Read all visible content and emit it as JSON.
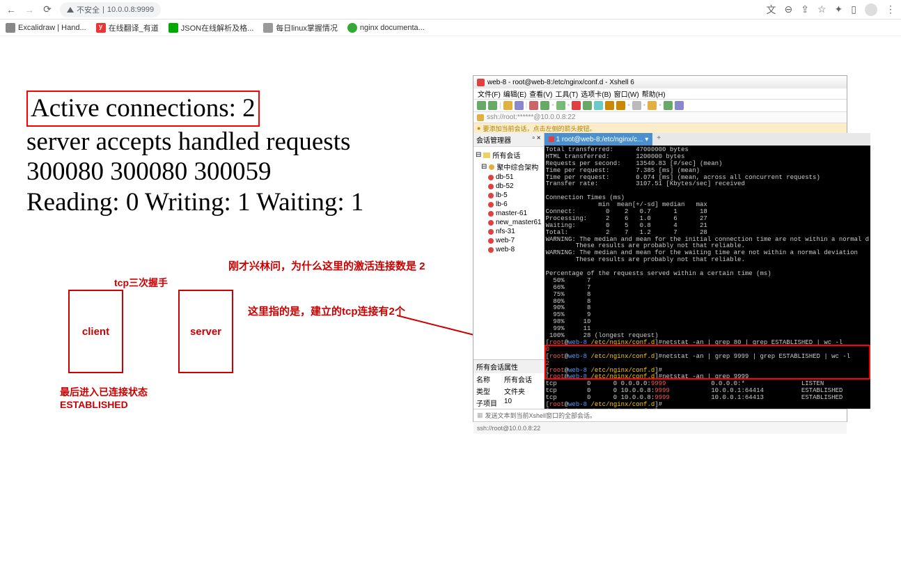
{
  "browser": {
    "not_secure": "不安全",
    "url": "10.0.0.8:9999",
    "bookmarks": [
      {
        "label": "Excalidraw | Hand...",
        "color": "#888"
      },
      {
        "label": "在线翻译_有道",
        "color": "#e33"
      },
      {
        "label": "JSON在线解析及格...",
        "color": "#3a3"
      },
      {
        "label": "每日linux掌握情况",
        "color": "#999"
      },
      {
        "label": "nginx documenta...",
        "color": "#3a3"
      }
    ]
  },
  "nginx": {
    "active_connections": "Active connections: 2 ",
    "line2": "server accepts handled requests",
    "line3": " 300080 300080 300059 ",
    "line4": "Reading: 0 Writing: 1 Waiting: 1"
  },
  "annot": {
    "q1": "刚才兴林问，为什么这里的激活连接数是 2",
    "q2": "这里指的是，建立的tcp连接有2个",
    "tcp_label": "tcp三次握手",
    "client_label": "client",
    "server_label": "server",
    "established": "最后进入已连接状态\nESTABLISHED"
  },
  "xshell": {
    "title": "web-8 - root@web-8:/etc/nginx/conf.d - Xshell 6",
    "menu": [
      "文件(F)",
      "编辑(E)",
      "查看(V)",
      "工具(T)",
      "选项卡(B)",
      "窗口(W)",
      "帮助(H)"
    ],
    "addr": "ssh://root:******@10.0.0.8:22",
    "hint": "要添加当前会话，点击左侧的箭头按钮。",
    "tree_title": "会话管理器",
    "tree_root": "所有会话",
    "tree": [
      {
        "label": "聚中综合架构",
        "color": "#e0b040"
      },
      {
        "label": "db-51",
        "color": "#e04040"
      },
      {
        "label": "db-52",
        "color": "#e04040"
      },
      {
        "label": "lb-5",
        "color": "#e04040"
      },
      {
        "label": "lb-6",
        "color": "#e04040"
      },
      {
        "label": "master-61",
        "color": "#e04040"
      },
      {
        "label": "new_master61",
        "color": "#e04040"
      },
      {
        "label": "nfs-31",
        "color": "#e04040"
      },
      {
        "label": "web-7",
        "color": "#e04040"
      },
      {
        "label": "web-8",
        "color": "#e04040"
      }
    ],
    "props_title": "所有会话属性",
    "props": [
      {
        "k": "名称",
        "v": "所有会话"
      },
      {
        "k": "类型",
        "v": "文件夹"
      },
      {
        "k": "子项目",
        "v": "10"
      }
    ],
    "tab": "1 root@web-8:/etc/nginx/c...",
    "term_pre": "Total transferred:      47000000 bytes\nHTML transferred:       1200000 bytes\nRequests per second:    13540.83 [#/sec] (mean)\nTime per request:       7.385 [ms] (mean)\nTime per request:       0.074 [ms] (mean, across all concurrent requests)\nTransfer rate:          3107.51 [Kbytes/sec] received\n\nConnection Times (ms)\n              min  mean[+/-sd] median   max\nConnect:        0    2   0.7      1      18\nProcessing:     2    6   1.0      6      27\nWaiting:        0    5   0.8      4      21\nTotal:          2    7   1.2      7      28\nWARNING: The median and mean for the initial connection time are not within a normal d\n        These results are probably not that reliable.\nWARNING: The median and mean for the waiting time are not within a normal deviation\n        These results are probably not that reliable.\n\nPercentage of the requests served within a certain time (ms)\n  50%      7\n  66%      7\n  75%      8\n  80%      8\n  90%      8\n  95%      9\n  98%     10\n  99%     11\n 100%     28 (longest request)",
    "cmd1": "netstat -an | grep 80 | grep ESTABLISHED | wc -l",
    "out1": "0",
    "cmd2": "netstat -an | grep 9999 | grep ESTABLISHED | wc -l",
    "out2": "2",
    "cmd3": "netstat -an | grep 9999",
    "netstat": "tcp        0      0 0.0.0.0:9999            0.0.0.0:*               LISTEN\ntcp        0      0 10.0.0.8:9999           10.0.0.1:64414          ESTABLISHED\ntcp        0      0 10.0.0.8:9999           10.0.0.1:64413          ESTABLISHED",
    "footer1": "发送文本到当前Xshell窗口的全部会话。",
    "footer2": "ssh://root@10.0.0.8:22"
  }
}
